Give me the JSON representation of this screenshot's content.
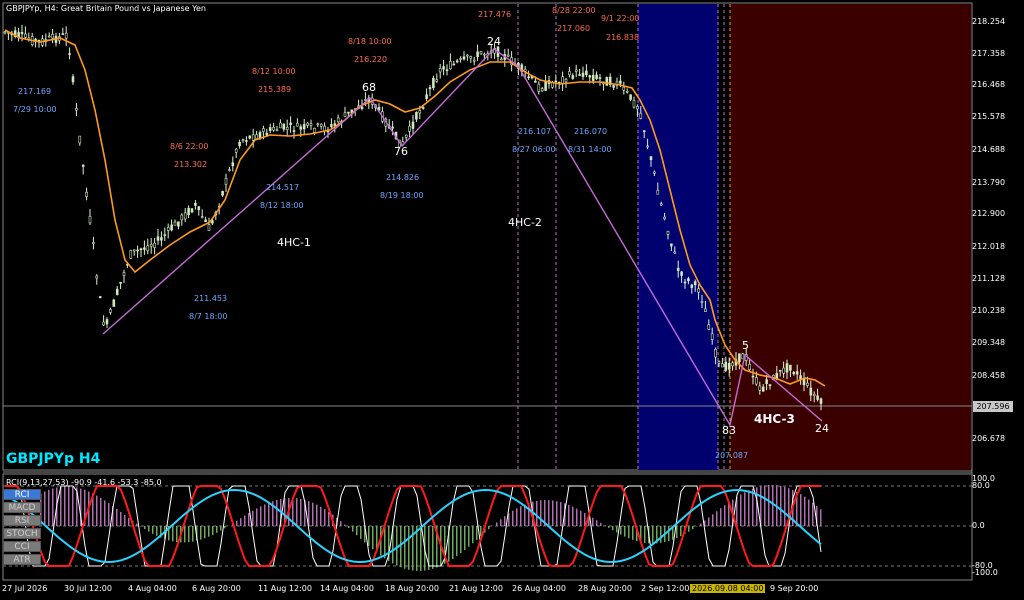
{
  "window": {
    "title": "GBPJPYp, H4:  Great Britain Pound vs Japanese Yen",
    "symbol_label": "GBPJPYp H4",
    "current_price": "207.596"
  },
  "colors": {
    "ma": "#ff9a1e",
    "zigzag": "#c46bd8",
    "zone_blue": "#00006e",
    "zone_red": "#3a0000",
    "blue_text": "#6ea6ff",
    "red_text": "#ff6b4a",
    "rci_fast": "#ffffff",
    "rci_mid": "#ff1a1a",
    "rci_slow": "#29d3ff"
  },
  "price_axis": [
    "218.254",
    "217.358",
    "216.468",
    "215.578",
    "214.688",
    "213.790",
    "212.900",
    "212.018",
    "211.128",
    "210.238",
    "209.348",
    "208.458",
    "207.596",
    "206.678"
  ],
  "osc_axis": [
    "100.0",
    "80.0",
    "0.0",
    "-80.0",
    "-100.0"
  ],
  "time_axis": [
    "27 Jul 2026",
    "30 Jul 12:00",
    "4 Aug 04:00",
    "6 Aug 20:00",
    "11 Aug 12:00",
    "14 Aug 04:00",
    "18 Aug 20:00",
    "21 Aug 12:00",
    "26 Aug 04:00",
    "28 Aug 20:00",
    "2 Sep 12:00",
    "2026.09.08 04:00",
    "9 Sep 20:00"
  ],
  "annotations": {
    "blue": [
      [
        "217.169"
      ],
      [
        "7/29 10:00"
      ],
      [
        "214.517"
      ],
      [
        "8/12 18:00"
      ],
      [
        "211.453"
      ],
      [
        "8/7 18:00"
      ],
      [
        "214.826"
      ],
      [
        "8/19 18:00"
      ],
      [
        "216.107"
      ],
      [
        "8/27 06:00"
      ],
      [
        "216.070"
      ],
      [
        "8/31 14:00"
      ],
      [
        "207.087"
      ]
    ],
    "red": [
      [
        "8/6 22:00"
      ],
      [
        "213.302"
      ],
      [
        "8/12 10:00"
      ],
      [
        "215.389"
      ],
      [
        "8/18 10:00"
      ],
      [
        "216.220"
      ],
      [
        "217.476"
      ],
      [
        "8/28 22:00"
      ],
      [
        "217.060"
      ],
      [
        "9/1 22:00"
      ],
      [
        "216.838"
      ]
    ],
    "white": [
      "68",
      "76",
      "24",
      "5",
      "83",
      "24",
      "4HC-1",
      "4HC-2",
      "4HC-3"
    ]
  },
  "indicators": {
    "rci_params": "RCI(9,13,27,53) -90.9 -41.6 -53.3 -85.0",
    "buttons": [
      "RCI",
      "MACD",
      "RSI",
      "STOCH",
      "CCI",
      "ATR"
    ],
    "active": "RCI"
  }
}
